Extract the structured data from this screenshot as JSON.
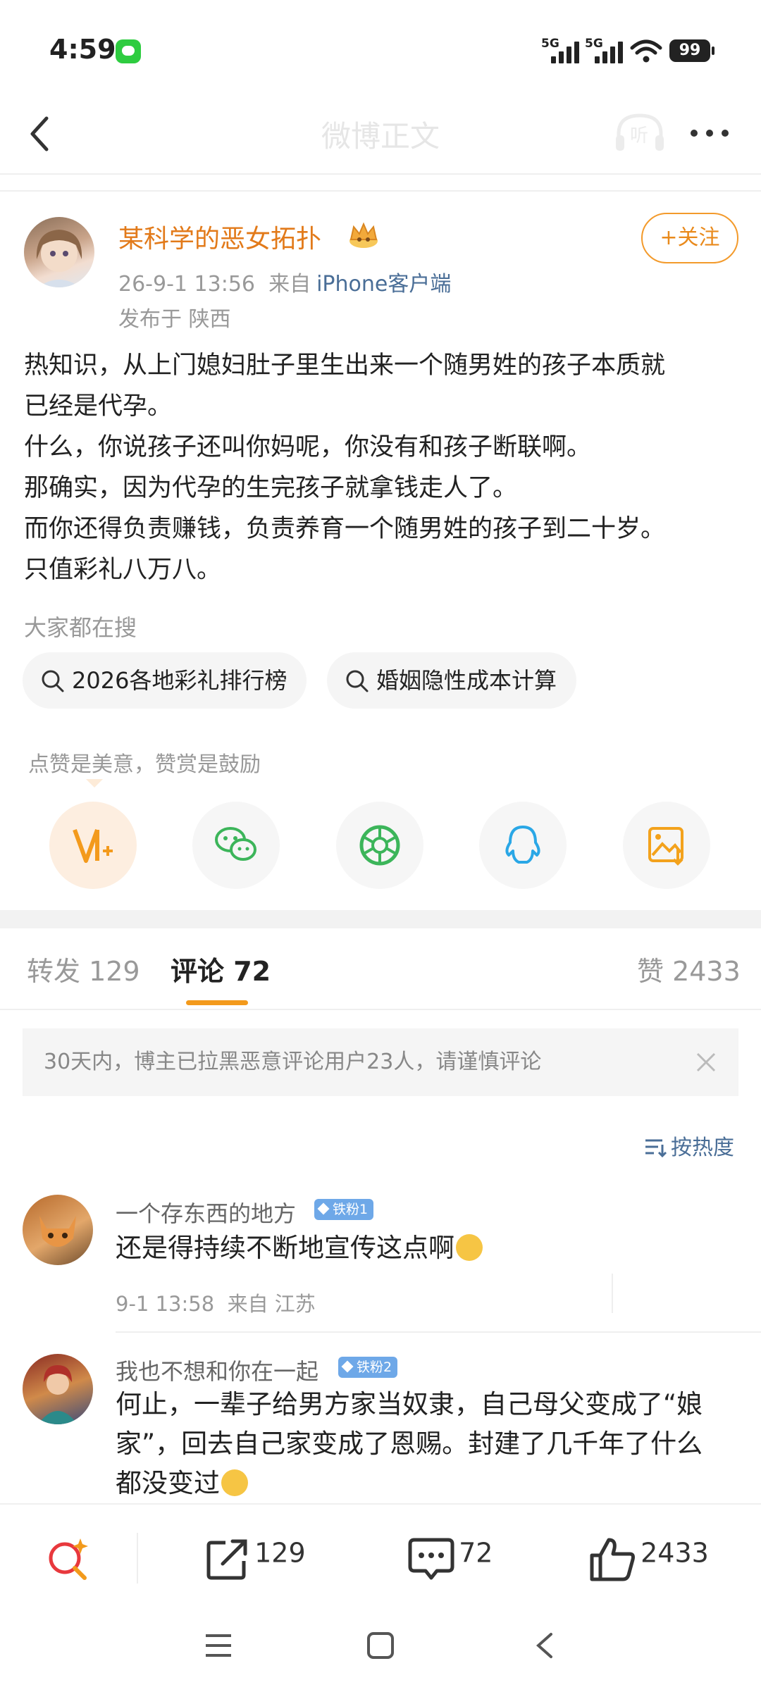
{
  "status_bar": {
    "time": "4:59",
    "signal_1": "5G",
    "signal_2": "5G",
    "battery": "99"
  },
  "nav": {
    "title": "微博正文",
    "listen_label": "听"
  },
  "post": {
    "author": "某科学的恶女拓扑",
    "follow_label": "+关注",
    "date": "26-9-1 13:56",
    "source_prefix": "来自",
    "source": "iPhone客户端",
    "location": "发布于 陕西",
    "lines": [
      "热知识，从上门媳妇肚子里生出来一个随男姓的孩子本质就",
      "已经是代孕。",
      "什么，你说孩子还叫你妈呢，你没有和孩子断联啊。",
      "那确实，因为代孕的生完孩子就拿钱走人了。",
      "而你还得负责赚钱，负责养育一个随男姓的孩子到二十岁。",
      "只值彩礼八万八。"
    ]
  },
  "search": {
    "heading": "大家都在搜",
    "pills": [
      "2026各地彩礼排行榜",
      "婚姻隐性成本计算"
    ]
  },
  "reward": {
    "tip": "点赞是美意，赞赏是鼓励"
  },
  "share_icons": [
    "reward-v-icon",
    "wechat-icon",
    "moments-icon",
    "qq-icon",
    "save-image-icon"
  ],
  "tabs": {
    "repost": "转发 129",
    "comment": "评论 72",
    "like": "赞 2433"
  },
  "notice": "30天内，博主已拉黑恶意评论用户23人，请谨慎评论",
  "sort_label": "按热度",
  "comments": [
    {
      "user": "一个存东西的地方",
      "badge": "铁粉1",
      "text": "还是得持续不断地宣传这点啊",
      "meta": "9-1 13:58  来自 江苏"
    },
    {
      "user": "我也不想和你在一起",
      "badge": "铁粉2",
      "lines": [
        "何止，一辈子给男方家当奴隶，自己母父变成了“娘",
        "家”，回去自己家变成了恩赐。封建了几千年了什么",
        "都没变过"
      ]
    }
  ],
  "bottom_bar": {
    "repost_count": "129",
    "comment_count": "72",
    "like_count": "2433"
  },
  "colors": {
    "accent": "#f39a1c",
    "author": "#e27a1a",
    "link": "#4a6e97"
  }
}
